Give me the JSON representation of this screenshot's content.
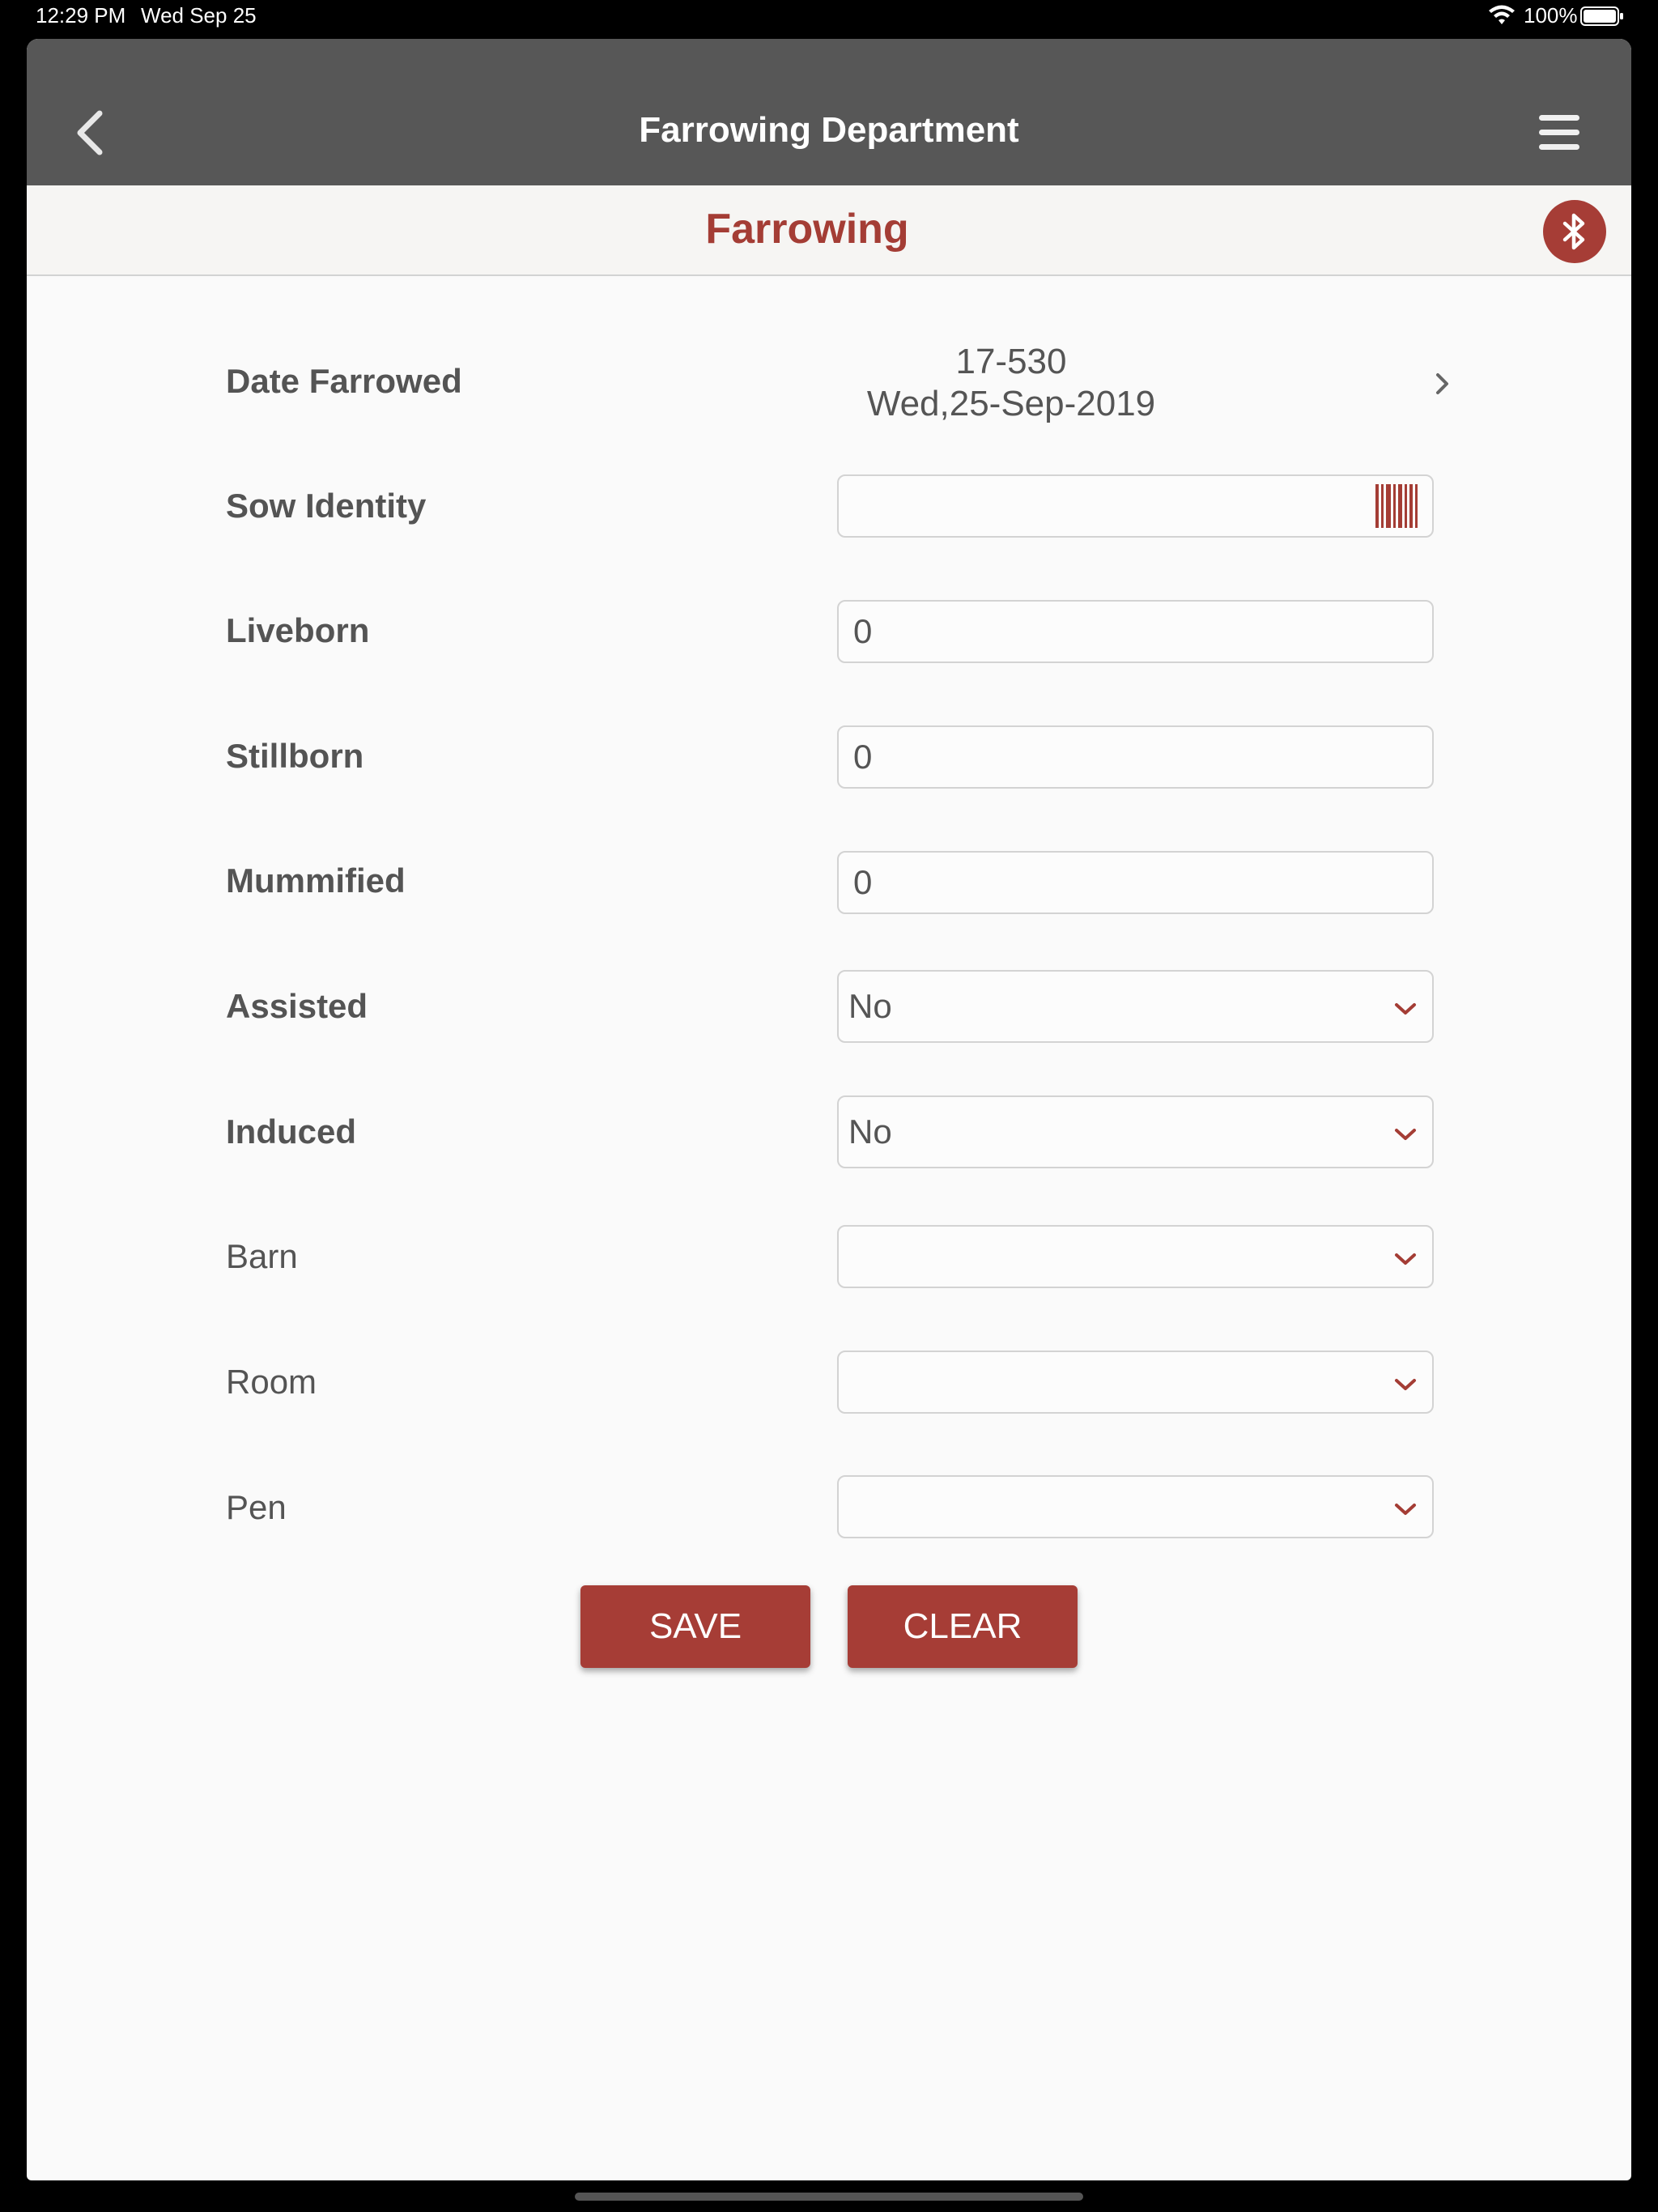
{
  "status_bar": {
    "time": "12:29 PM",
    "date": "Wed Sep 25",
    "battery": "100%"
  },
  "nav": {
    "title": "Farrowing Department",
    "back_icon": "chevron-left-icon",
    "menu_icon": "hamburger-menu-icon"
  },
  "sub_header": {
    "title": "Farrowing",
    "bluetooth_icon": "bluetooth-icon",
    "accent_color": "#a63d36"
  },
  "form": {
    "date_farrowed": {
      "label": "Date Farrowed",
      "code": "17-530",
      "date": "Wed,25-Sep-2019"
    },
    "sow_identity": {
      "label": "Sow Identity",
      "value": ""
    },
    "liveborn": {
      "label": "Liveborn",
      "value": "0"
    },
    "stillborn": {
      "label": "Stillborn",
      "value": "0"
    },
    "mummified": {
      "label": "Mummified",
      "value": "0"
    },
    "assisted": {
      "label": "Assisted",
      "value": "No"
    },
    "induced": {
      "label": "Induced",
      "value": "No"
    },
    "barn": {
      "label": "Barn",
      "value": ""
    },
    "room": {
      "label": "Room",
      "value": ""
    },
    "pen": {
      "label": "Pen",
      "value": ""
    }
  },
  "actions": {
    "save_label": "SAVE",
    "clear_label": "CLEAR"
  }
}
